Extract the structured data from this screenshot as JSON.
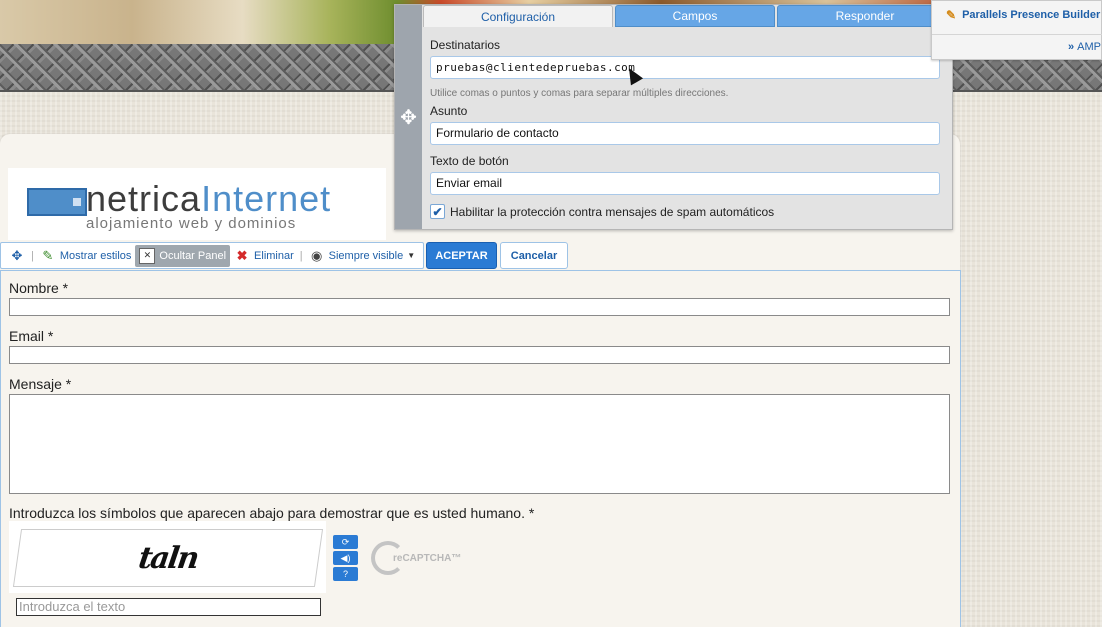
{
  "logo": {
    "name_part1": "netrica",
    "name_part2": "Internet",
    "tagline": "alojamiento web y dominios"
  },
  "toolbar": {
    "show_styles": "Mostrar estilos",
    "hide_panel": "Ocultar Panel",
    "delete": "Eliminar",
    "always_visible": "Siempre visible",
    "accept": "ACEPTAR",
    "cancel": "Cancelar"
  },
  "form": {
    "name_label": "Nombre *",
    "email_label": "Email *",
    "message_label": "Mensaje *",
    "captcha_label": "Introduzca los símbolos que aparecen abajo para demostrar que es usted humano. *",
    "captcha_text": "taln",
    "captcha_input_placeholder": "Introduzca el texto",
    "recaptcha_logo": "reCAPTCHA™"
  },
  "dialog": {
    "tabs": [
      "Configuración",
      "Campos",
      "Responder"
    ],
    "active_tab": "Configuración",
    "recipients_label": "Destinatarios",
    "recipients_value": "pruebas@clientedepruebas.com",
    "recipients_hint": "Utilice comas o puntos y comas para separar múltiples direcciones.",
    "subject_label": "Asunto",
    "subject_value": "Formulario de contacto",
    "button_text_label": "Texto de botón",
    "button_text_value": "Enviar email",
    "spam_label": "Habilitar la protección contra mensajes de spam automáticos",
    "spam_checked": true
  },
  "presence_builder": {
    "title": "Parallels Presence Builder",
    "more": "AMP"
  },
  "colors": {
    "accent": "#2b7bd4",
    "link": "#1e5fa8",
    "tab_inactive": "#66a6e6"
  }
}
